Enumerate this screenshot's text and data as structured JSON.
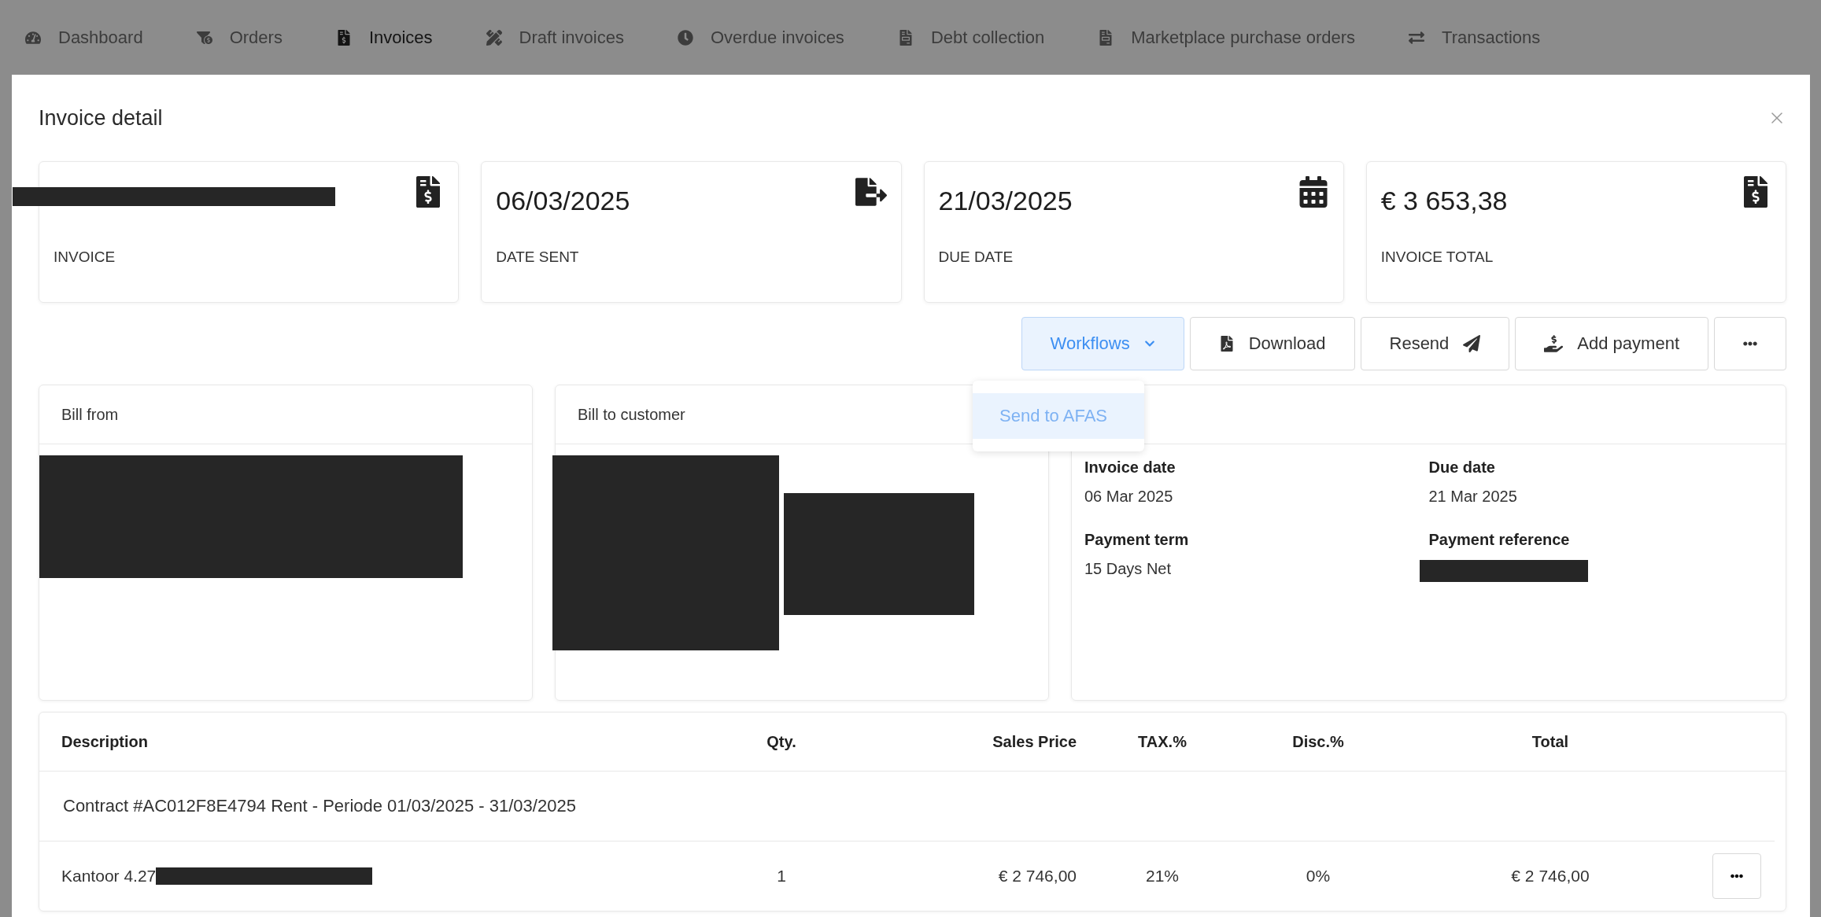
{
  "nav": [
    {
      "label": "Dashboard",
      "selected": false
    },
    {
      "label": "Orders",
      "selected": false
    },
    {
      "label": "Invoices",
      "selected": true
    },
    {
      "label": "Draft invoices",
      "selected": false
    },
    {
      "label": "Overdue invoices",
      "selected": false
    },
    {
      "label": "Debt collection",
      "selected": false
    },
    {
      "label": "Marketplace purchase orders",
      "selected": false
    },
    {
      "label": "Transactions",
      "selected": false
    }
  ],
  "modal": {
    "title": "Invoice detail"
  },
  "summary_cards": [
    {
      "kind": "redacted",
      "label": "INVOICE"
    },
    {
      "kind": "text",
      "value": "06/03/2025",
      "label": "DATE SENT"
    },
    {
      "kind": "text",
      "value": "21/03/2025",
      "label": "DUE DATE"
    },
    {
      "kind": "text",
      "value": "€ 3 653,38",
      "label": "INVOICE TOTAL"
    }
  ],
  "actions": [
    {
      "label": "Workflows",
      "kind": "dropdown"
    },
    {
      "label": "Download",
      "kind": "pdf"
    },
    {
      "label": "Resend",
      "kind": "send"
    },
    {
      "label": "Add payment",
      "kind": "payment"
    },
    {
      "kind": "more"
    }
  ],
  "workflow_menu": {
    "items": [
      "Send to AFAS"
    ]
  },
  "bill_from": {
    "title": "Bill from"
  },
  "bill_to": {
    "title": "Bill to customer"
  },
  "details": [
    {
      "kind": "text",
      "label": "Invoice date",
      "value": "06 Mar 2025"
    },
    {
      "kind": "text",
      "label": "Due date",
      "value": "21 Mar 2025"
    },
    {
      "kind": "text",
      "label": "Payment term",
      "value": "15 Days Net"
    },
    {
      "kind": "redacted",
      "label": "Payment reference"
    }
  ],
  "table": {
    "columns": [
      "Description",
      "Qty.",
      "Sales Price",
      "TAX.%",
      "Disc.%",
      "Total"
    ],
    "group": "Contract #AC012F8E4794 Rent - Periode 01/03/2025 - 31/03/2025",
    "rows": [
      {
        "description": "Kantoor 4.27",
        "qty": "1",
        "sales_price": "€ 2 746,00",
        "tax": "21%",
        "disc": "0%",
        "total": "€ 2 746,00"
      }
    ]
  }
}
